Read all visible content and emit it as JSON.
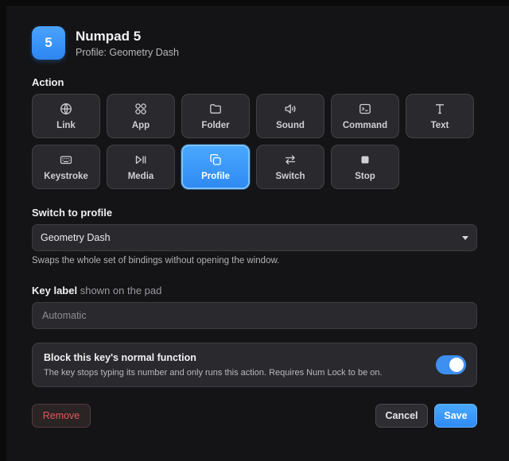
{
  "header": {
    "key_badge": "5",
    "title": "Numpad 5",
    "subtitle": "Profile: Geometry Dash"
  },
  "action": {
    "label": "Action",
    "selected": "Profile",
    "options": [
      {
        "label": "Link",
        "icon": "globe-icon"
      },
      {
        "label": "App",
        "icon": "apps-grid-icon"
      },
      {
        "label": "Folder",
        "icon": "folder-icon"
      },
      {
        "label": "Sound",
        "icon": "speaker-icon"
      },
      {
        "label": "Command",
        "icon": "terminal-icon"
      },
      {
        "label": "Text",
        "icon": "text-icon"
      },
      {
        "label": "Keystroke",
        "icon": "keyboard-icon"
      },
      {
        "label": "Media",
        "icon": "play-pause-icon"
      },
      {
        "label": "Profile",
        "icon": "copy-icon"
      },
      {
        "label": "Switch",
        "icon": "swap-arrows-icon"
      },
      {
        "label": "Stop",
        "icon": "stop-icon"
      }
    ]
  },
  "switch_profile": {
    "label": "Switch to profile",
    "value": "Geometry Dash",
    "hint": "Swaps the whole set of bindings without opening the window."
  },
  "key_label": {
    "label": "Key label",
    "label_suffix": "shown on the pad",
    "placeholder": "Automatic",
    "value": ""
  },
  "block_function": {
    "title": "Block this key's normal function",
    "description": "The key stops typing its number and only runs this action. Requires Num Lock to be on.",
    "enabled": true
  },
  "buttons": {
    "remove": "Remove",
    "cancel": "Cancel",
    "save": "Save"
  },
  "colors": {
    "accent": "#3d8ff0",
    "danger": "#e05a5a",
    "background": "#141416"
  }
}
